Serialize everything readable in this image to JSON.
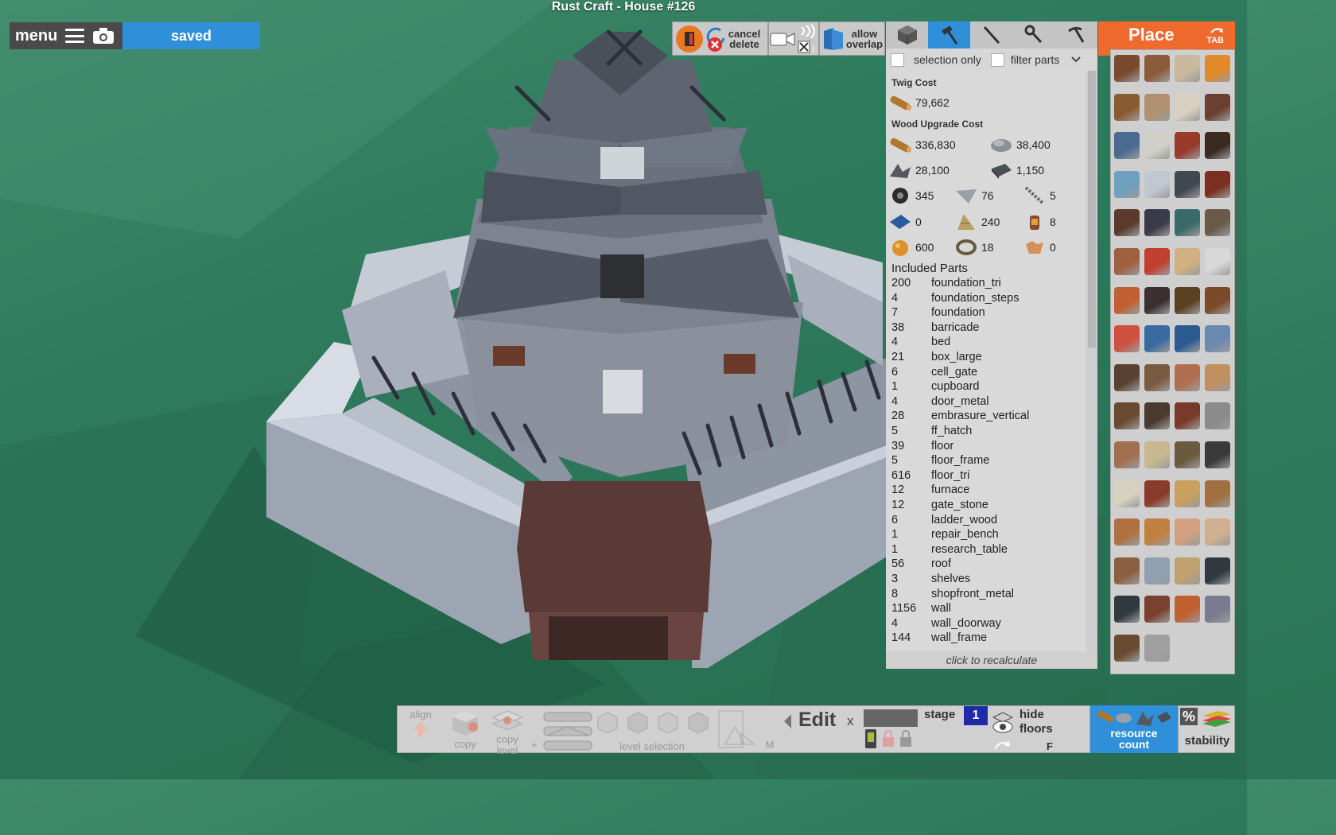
{
  "window": {
    "title": "Rust Craft - House #126"
  },
  "topbar": {
    "menu_label": "menu",
    "saved_label": "saved"
  },
  "toolbar": {
    "cancel_delete": [
      "cancel",
      "delete"
    ],
    "allow_overlap": [
      "allow",
      "overlap"
    ],
    "tools": [
      "cube-icon",
      "hammer-icon",
      "knife-icon",
      "wrench-icon",
      "pickaxe-icon"
    ]
  },
  "filters": {
    "selection_only": "selection only",
    "filter_parts": "filter parts"
  },
  "costs": {
    "twig_title": "Twig Cost",
    "twig": [
      {
        "icon": "wood-icon",
        "value": "79,662"
      }
    ],
    "wood_title": "Wood Upgrade Cost",
    "wood": [
      {
        "icon": "wood-icon",
        "value": "336,830"
      },
      {
        "icon": "stones-icon",
        "value": "38,400"
      },
      {
        "icon": "metal-fragments-icon",
        "value": "28,100"
      },
      {
        "icon": "hq-metal-icon",
        "value": "1,150"
      },
      {
        "icon": "gears-icon",
        "value": "345"
      },
      {
        "icon": "sheet-metal-icon",
        "value": "76"
      },
      {
        "icon": "rope-ladder-icon",
        "value": "5"
      },
      {
        "icon": "tarp-icon",
        "value": "0"
      },
      {
        "icon": "cloth-icon",
        "value": "240"
      },
      {
        "icon": "lantern-icon",
        "value": "8"
      },
      {
        "icon": "low-grade-fuel-icon",
        "value": "600"
      },
      {
        "icon": "rope-icon",
        "value": "18"
      },
      {
        "icon": "leather-icon",
        "value": "0"
      }
    ]
  },
  "parts": {
    "title": "Included Parts",
    "items": [
      {
        "count": "200",
        "name": "foundation_tri"
      },
      {
        "count": "4",
        "name": "foundation_steps"
      },
      {
        "count": "7",
        "name": "foundation"
      },
      {
        "count": "38",
        "name": "barricade"
      },
      {
        "count": "4",
        "name": "bed"
      },
      {
        "count": "21",
        "name": "box_large"
      },
      {
        "count": "6",
        "name": "cell_gate"
      },
      {
        "count": "1",
        "name": "cupboard"
      },
      {
        "count": "4",
        "name": "door_metal"
      },
      {
        "count": "28",
        "name": "embrasure_vertical"
      },
      {
        "count": "5",
        "name": "ff_hatch"
      },
      {
        "count": "39",
        "name": "floor"
      },
      {
        "count": "5",
        "name": "floor_frame"
      },
      {
        "count": "616",
        "name": "floor_tri"
      },
      {
        "count": "12",
        "name": "furnace"
      },
      {
        "count": "12",
        "name": "gate_stone"
      },
      {
        "count": "6",
        "name": "ladder_wood"
      },
      {
        "count": "1",
        "name": "repair_bench"
      },
      {
        "count": "1",
        "name": "research_table"
      },
      {
        "count": "56",
        "name": "roof"
      },
      {
        "count": "3",
        "name": "shelves"
      },
      {
        "count": "8",
        "name": "shopfront_metal"
      },
      {
        "count": "1156",
        "name": "wall"
      },
      {
        "count": "4",
        "name": "wall_doorway"
      },
      {
        "count": "144",
        "name": "wall_frame"
      }
    ],
    "recalc": "click to recalculate"
  },
  "place": {
    "title": "Place",
    "tab_hint": "TAB",
    "colors": [
      "#7a4a2e",
      "#8b5a3a",
      "#c9b8a0",
      "#e08a2a",
      "#8a5a30",
      "#b09070",
      "#d8d0c0",
      "#6a4030",
      "#4a6a90",
      "#d0d0c8",
      "#9a3a2a",
      "#3a2a20",
      "#70a0c0",
      "#c0c8d0",
      "#404850",
      "#7a3020",
      "#5a3a2a",
      "#3a3a4a",
      "#3a6a6a",
      "#6a5a4a",
      "#a06040",
      "#c04030",
      "#d0b080",
      "#d8d8d8",
      "#c06030",
      "#3a3030",
      "#5a4020",
      "#7a4a2a",
      "#d05040",
      "#3a6aa0",
      "#2a5a90",
      "#6a8ab0",
      "#5a4030",
      "#7a5a40",
      "#b07050",
      "#c09060",
      "#6a4a30",
      "#4a3a30",
      "#7a3a2a",
      "#8a8a8a",
      "#a07050",
      "#c8b890",
      "#6a5a40",
      "#3a3a3a",
      "#d8d0c0",
      "#8a3a2a",
      "#c8a060",
      "#a07040",
      "#b07040",
      "#c08040",
      "#d0a080",
      "#d0b090",
      "#8a6040",
      "#90a0b0",
      "#c0a070",
      "#303840",
      "#303840",
      "#7a4030",
      "#c06030",
      "#7a7a90",
      "#6a4a30",
      "#a0a0a0"
    ]
  },
  "bottombar": {
    "align": "align",
    "copy": "copy",
    "copy_level": [
      "copy",
      "level"
    ],
    "level_selection": "level selection",
    "m_key": "M",
    "edit": "Edit",
    "edit_close": "x",
    "stage_label": "stage",
    "stage_value": "1",
    "hide_floors": [
      "hide",
      "floors"
    ],
    "f_key": "F",
    "resource_count": [
      "resource",
      "count"
    ],
    "percent": "%",
    "stability": "stability"
  }
}
